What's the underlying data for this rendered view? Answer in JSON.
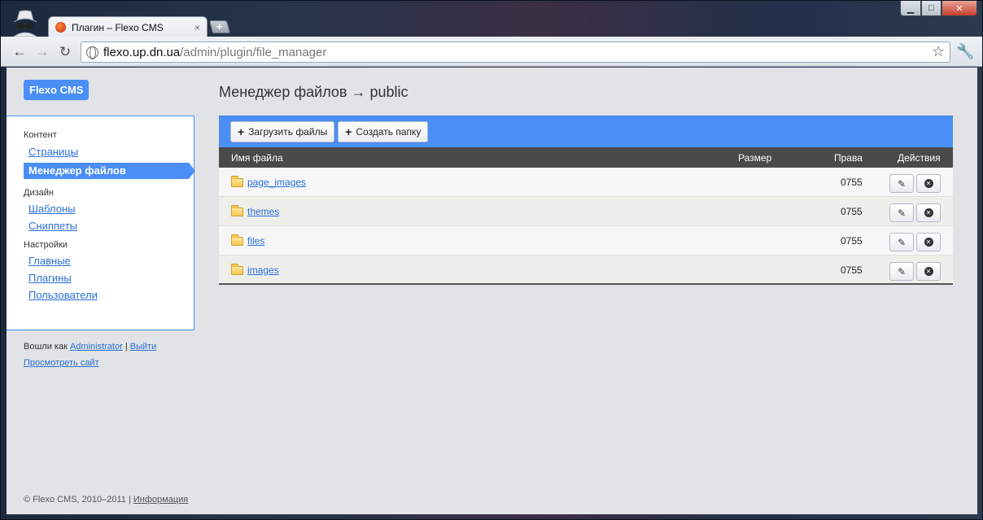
{
  "browser": {
    "tab_title": "Плагин – Flexo CMS",
    "tab_close": "×",
    "new_tab": "+",
    "url_host": "flexo.up.dn.ua",
    "url_path": "/admin/plugin/file_manager",
    "icons": [
      "incognito-icon",
      "favicon-icon",
      "back-icon",
      "forward-icon",
      "reload-icon",
      "globe-icon",
      "star-icon",
      "wrench-icon"
    ]
  },
  "window_buttons": {
    "minimize": "▁",
    "maximize": "□",
    "close": "✕"
  },
  "logo": "Flexo CMS",
  "sidebar": {
    "groups": [
      {
        "label": "Контент",
        "items": [
          "Страницы",
          "Менеджер файлов"
        ]
      },
      {
        "label": "Дизайн",
        "items": [
          "Шаблоны",
          "Сниппеты"
        ]
      },
      {
        "label": "Настройки",
        "items": [
          "Главные",
          "Плагины",
          "Пользователи"
        ]
      }
    ],
    "active_item": "Менеджер файлов"
  },
  "login": {
    "prefix": "Вошли как",
    "user": "Administrator",
    "separator": "|",
    "logout": "Выйти",
    "view_site": "Просмотреть сайт"
  },
  "footer": {
    "copyright": "© Flexo CMS, 2010–2011 |",
    "info": "Информация"
  },
  "main": {
    "title": "Менеджер файлов → public",
    "toolbar": {
      "upload": "Загрузить файлы",
      "create_folder": "Создать папку"
    },
    "columns": {
      "name": "Имя файла",
      "size": "Размер",
      "perms": "Права",
      "actions": "Действия"
    },
    "rows": [
      {
        "name": "page_images",
        "perms": "0755"
      },
      {
        "name": "themes",
        "perms": "0755"
      },
      {
        "name": "files",
        "perms": "0755"
      },
      {
        "name": "images",
        "perms": "0755"
      }
    ]
  },
  "colors": {
    "accent": "#4a8ef6",
    "table_header": "#4a4a4a",
    "page_bg": "#e2e3e6"
  }
}
